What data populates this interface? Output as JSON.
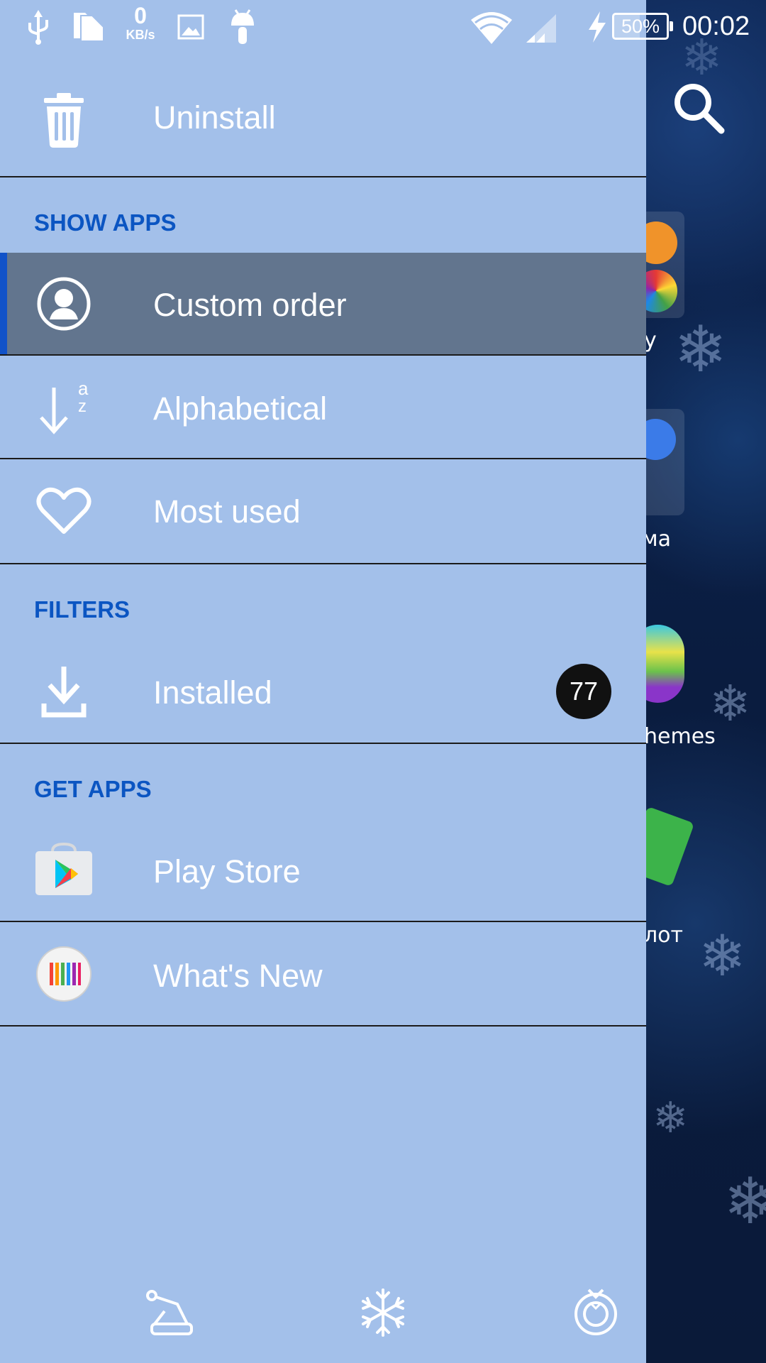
{
  "status_bar": {
    "network_speed_value": "0",
    "network_speed_unit": "KB/s",
    "battery_level": "50%",
    "time": "00:02",
    "icons": [
      "usb-icon",
      "sim-cards-icon",
      "image-icon",
      "android-icon",
      "wifi-icon",
      "signal-icon",
      "charging-icon",
      "battery-icon"
    ]
  },
  "drawer": {
    "top_item": {
      "label": "Uninstall",
      "icon": "trash-icon"
    },
    "sections": [
      {
        "title": "SHOW APPS",
        "items": [
          {
            "label": "Custom order",
            "icon": "person-circle-icon",
            "selected": true
          },
          {
            "label": "Alphabetical",
            "icon": "sort-az-icon"
          },
          {
            "label": "Most used",
            "icon": "heart-icon"
          }
        ]
      },
      {
        "title": "FILTERS",
        "items": [
          {
            "label": "Installed",
            "icon": "download-icon",
            "badge": "77"
          }
        ]
      },
      {
        "title": "GET APPS",
        "items": [
          {
            "label": "Play Store",
            "icon": "play-store-icon"
          },
          {
            "label": "What's New",
            "icon": "whats-new-icon"
          }
        ]
      }
    ],
    "bottom_icons": [
      "santa-hat-icon",
      "snowflake-icon",
      "wreath-icon"
    ]
  },
  "background": {
    "search_icon": "search-icon",
    "partial_labels": [
      "y",
      "ма",
      "hemes",
      "лот"
    ],
    "accent": "#a3c0ea",
    "selected_bg": "#62758e",
    "section_color": "#0b55c2"
  }
}
